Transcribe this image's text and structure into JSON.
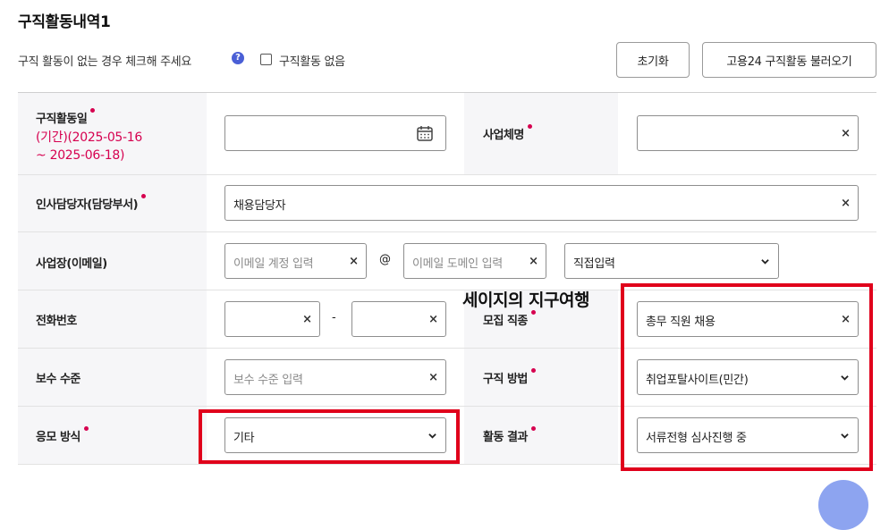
{
  "page": {
    "title": "구직활동내역1",
    "notice": "구직 활동이 없는 경우 체크해 주세요",
    "help_glyph": "?",
    "no_activity_label": "구직활동 없음",
    "reset_label": "초기화",
    "import_label": "고용24 구직활동 불러오기"
  },
  "form": {
    "activity_date": {
      "label": "구직활동일",
      "range_line1": "(기간)(2025-05-16",
      "range_line2": "~ 2025-06-18)",
      "value": ""
    },
    "business_name": {
      "label": "사업체명",
      "value": ""
    },
    "hr_manager": {
      "label": "인사담당자(담당부서)",
      "value": "채용담당자"
    },
    "email": {
      "label": "사업장(이메일)",
      "account_placeholder": "이메일 계정 입력",
      "at_sign": "@",
      "domain_placeholder": "이메일 도메인 입력",
      "domain_select": "직접입력"
    },
    "phone": {
      "label": "전화번호",
      "dash": "-"
    },
    "job_type": {
      "label": "모집 직종",
      "value": "총무 직원 채용"
    },
    "salary": {
      "label": "보수 수준",
      "placeholder": "보수 수준 입력"
    },
    "search_method": {
      "label": "구직 방법",
      "value": "취업포탈사이트(민간)"
    },
    "apply_method": {
      "label": "응모 방식",
      "value": "기타"
    },
    "result": {
      "label": "활동 결과",
      "value": "서류전형 심사진행 중"
    }
  },
  "overlay_text": "세이지의 지구여행",
  "icons": {
    "calendar": "calendar-icon",
    "clear": "×",
    "dropdown": "chevron-down-icon",
    "help": "help-icon"
  },
  "colors": {
    "required_dot": "#d6004f",
    "highlight_box": "#e0001b",
    "help_icon": "#4a5fd6",
    "label_bg": "#f6f6f8"
  }
}
